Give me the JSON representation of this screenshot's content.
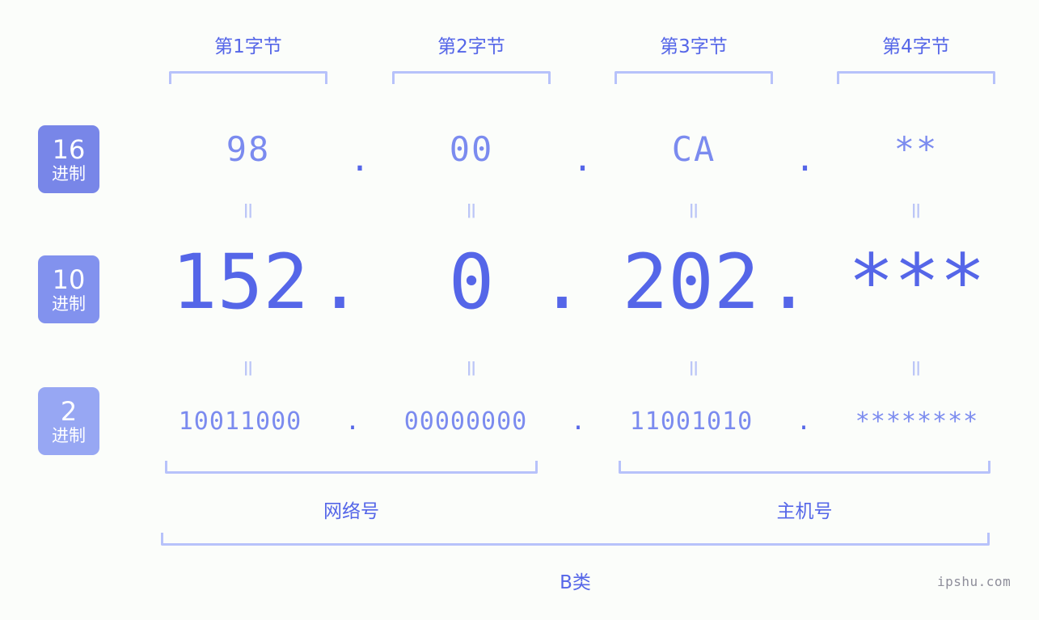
{
  "page": {
    "background_color": "#fbfdfa",
    "accent_color": "#5566e8",
    "accent_light_color": "#7b8bef",
    "bracket_color": "#b7c2fa",
    "watermark": "ipshu.com"
  },
  "byte_headers": [
    {
      "label": "第1字节"
    },
    {
      "label": "第2字节"
    },
    {
      "label": "第3字节"
    },
    {
      "label": "第4字节"
    }
  ],
  "bases": [
    {
      "num": "16",
      "unit": "进制",
      "color": "#7886e8"
    },
    {
      "num": "10",
      "unit": "进制",
      "color": "#8292ee"
    },
    {
      "num": "2",
      "unit": "进制",
      "color": "#97a7f3"
    }
  ],
  "rows": {
    "hex": {
      "values": [
        "98",
        "00",
        "CA",
        "**"
      ],
      "separator": "."
    },
    "dec": {
      "values": [
        "152",
        "0",
        "202",
        "***"
      ],
      "separator": "."
    },
    "bin": {
      "values": [
        "10011000",
        "00000000",
        "11001010",
        "********"
      ],
      "separator": "."
    }
  },
  "equals_mark": "=",
  "sections": [
    {
      "label": "网络号"
    },
    {
      "label": "主机号"
    }
  ],
  "class": {
    "label": "B类"
  }
}
